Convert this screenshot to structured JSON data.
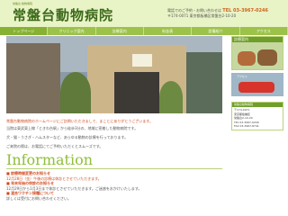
{
  "header": {
    "tagline": "常盤台 動物病院",
    "logo": "常盤台動物病院",
    "note": "電話でのご予約・お問い合わせは",
    "tel": "TEL 03-3967-0246",
    "address": "〒174-0071 東京都板橋区常盤台2-10-20"
  },
  "nav": [
    "トップページ",
    "クリニック案内",
    "診療案内",
    "料金表",
    "設備紹介",
    "アクセス"
  ],
  "side": {
    "title1": "診療案内",
    "img2_label": "アクセス",
    "info_title": "常盤台動物病院",
    "info_lines": [
      "〒174-0071",
      "東京都板橋区",
      "常盤台2-10-20",
      "TEL 03-3967-0246",
      "FAX 03-3967-8741"
    ]
  },
  "intro": {
    "head": "常盤台動物病院のホームページにご訪問いただきまして、まことにありがとうございます。",
    "p1": "当院は東武東上線「ときわ台駅」から徒歩3分の、地域に密着した動物病院です。",
    "p2": "犬・猫・うさぎ・ハムスターなど、あらゆる動物の診療を行っております。",
    "p3": "ご来院の際は、お電話にてご予約いただくとスムーズです。"
  },
  "information": {
    "title": "Information",
    "items": [
      {
        "head": "診療時間変更のお知らせ",
        "body": "12月28日（金）午後の診療は休診とさせていただきます。"
      },
      {
        "head": "年末年始の休診のお知らせ",
        "body": "12月29日から1月3日まで休診とさせていただきます。ご迷惑をおかけいたします。"
      },
      {
        "head": "混合ワクチン接種について",
        "body": "詳しくは受付にお問い合わせください。"
      }
    ]
  }
}
